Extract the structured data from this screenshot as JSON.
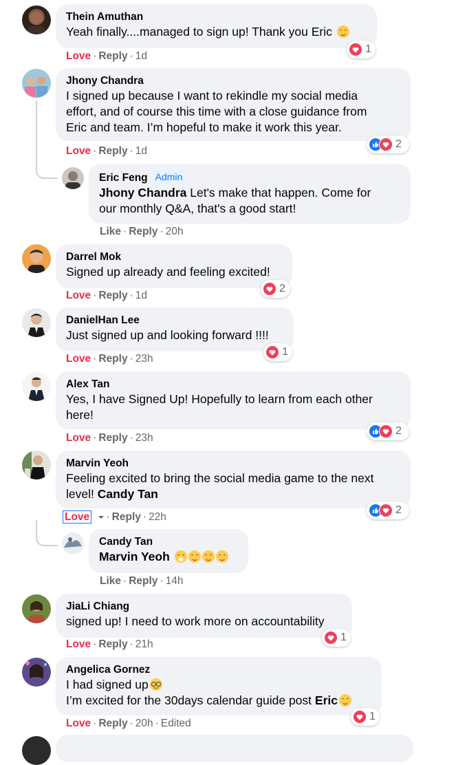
{
  "comments": [
    {
      "name": "Thein Amuthan",
      "text": "Yeah finally....managed to sign up! Thank you Eric",
      "reaction_label": "Love",
      "reply_label": "Reply",
      "time": "1d",
      "count": "1"
    },
    {
      "name": "Jhony Chandra",
      "lines": [
        "I signed up because I want to rekindle my social media",
        "effort, and of course this time with a close guidance from",
        "Eric and team. I’m hopeful to make it work this year."
      ],
      "reaction_label": "Love",
      "reply_label": "Reply",
      "time": "1d",
      "count": "2"
    },
    {
      "name": "Eric Feng",
      "badge": "Admin",
      "mention": "Jhony Chandra",
      "text_after": " Let's make that happen. Come for",
      "line2": "our monthly Q&A, that's a good start!",
      "reaction_label": "Like",
      "reply_label": "Reply",
      "time": "20h"
    },
    {
      "name": "Darrel Mok",
      "text": "Signed up already and feeling excited!",
      "reaction_label": "Love",
      "reply_label": "Reply",
      "time": "1d",
      "count": "2"
    },
    {
      "name": "DanielHan Lee",
      "text": "Just signed up and looking forward !!!!",
      "reaction_label": "Love",
      "reply_label": "Reply",
      "time": "23h",
      "count": "1"
    },
    {
      "name": "Alex Tan",
      "lines": [
        "Yes, I have Signed Up! Hopefully to learn from each other",
        "here!"
      ],
      "reaction_label": "Love",
      "reply_label": "Reply",
      "time": "23h",
      "count": "2"
    },
    {
      "name": "Marvin Yeoh",
      "line1": "Feeling excited to bring the social media game to the next",
      "line2_pre": "level! ",
      "mention": "Candy Tan",
      "reaction_label": "Love",
      "reply_label": "Reply",
      "time": "22h",
      "count": "2"
    },
    {
      "name": "Candy Tan",
      "mention": "Marvin Yeoh",
      "reaction_label": "Like",
      "reply_label": "Reply",
      "time": "14h"
    },
    {
      "name": "JiaLi Chiang",
      "text": "signed up! I need to work more on accountability",
      "reaction_label": "Love",
      "reply_label": "Reply",
      "time": "21h",
      "count": "1"
    },
    {
      "name": "Angelica Gornez",
      "line1": "I had signed up",
      "line2_pre": "I’m excited for the 30days calendar guide post ",
      "mention": "Eric",
      "reaction_label": "Love",
      "reply_label": "Reply",
      "time": "20h",
      "edited": "Edited",
      "count": "1"
    }
  ],
  "colors": {
    "love": "#f0284a",
    "bubble": "#f0f2f5",
    "meta": "#65676b",
    "like": "#1877f2",
    "heart": "#f33e58"
  }
}
